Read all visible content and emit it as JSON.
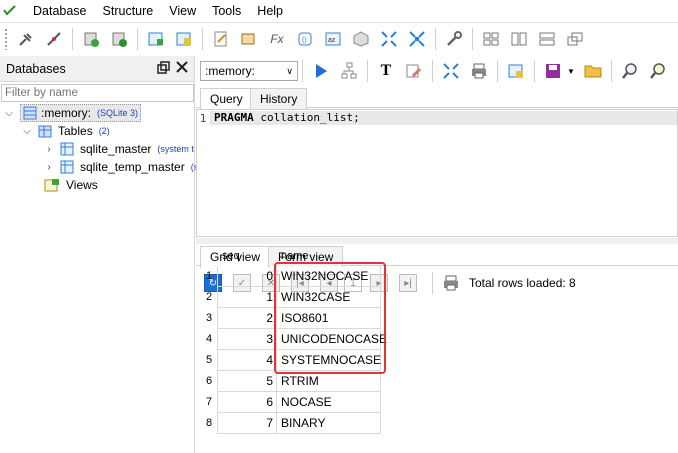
{
  "menubar": {
    "items": [
      "Database",
      "Structure",
      "View",
      "Tools",
      "Help"
    ]
  },
  "toolbar_icons": [
    "plug-icon",
    "unplug-icon",
    "db-add-icon",
    "db-refresh-icon",
    "table-new-icon",
    "table-edit-icon",
    "sql-editor-icon",
    "sql-run-icon",
    "function-icon",
    "collation-icon",
    "sort-icon",
    "package-icon",
    "expand-icon",
    "collapse-icon",
    "wrench-icon",
    "layout-grid-icon",
    "layout-columns-icon",
    "layout-rows-icon",
    "layout-cascade-icon"
  ],
  "left_panel": {
    "title": "Databases",
    "filter_placeholder": "Filter by name",
    "tree": {
      "db_name": ":memory:",
      "db_type": "(SQLite 3)",
      "tables_label": "Tables",
      "tables_count": "(2)",
      "tables": [
        {
          "name": "sqlite_master",
          "note": "(system t"
        },
        {
          "name": "sqlite_temp_master",
          "note": "(s"
        }
      ],
      "views_label": "Views"
    }
  },
  "editor_toolbar": {
    "db_selected": ":memory:"
  },
  "editor_tabs": [
    "Query",
    "History"
  ],
  "editor": {
    "line_number": "1",
    "keyword": "PRAGMA",
    "rest": " collation_list;"
  },
  "result_tabs": [
    "Grid view",
    "Form view"
  ],
  "grid_toolbar": {
    "page": "1",
    "rows_loaded": "Total rows loaded: 8"
  },
  "grid": {
    "columns": [
      "seq",
      "name"
    ],
    "rows": [
      {
        "num": "1",
        "seq": "0",
        "name": "WIN32NOCASE"
      },
      {
        "num": "2",
        "seq": "1",
        "name": "WIN32CASE"
      },
      {
        "num": "3",
        "seq": "2",
        "name": "ISO8601"
      },
      {
        "num": "4",
        "seq": "3",
        "name": "UNICODENOCASE"
      },
      {
        "num": "5",
        "seq": "4",
        "name": "SYSTEMNOCASE"
      },
      {
        "num": "6",
        "seq": "5",
        "name": "RTRIM"
      },
      {
        "num": "7",
        "seq": "6",
        "name": "NOCASE"
      },
      {
        "num": "8",
        "seq": "7",
        "name": "BINARY"
      }
    ]
  },
  "colors": {
    "highlight": "#e0333a",
    "accent_blue": "#1d6fd6"
  }
}
